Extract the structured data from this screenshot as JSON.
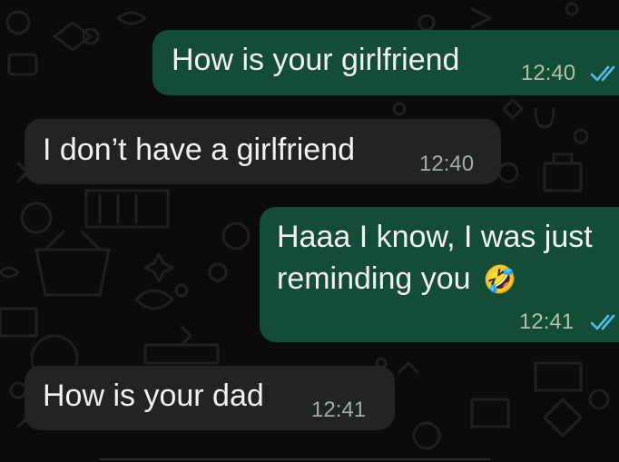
{
  "chat": {
    "messages": [
      {
        "direction": "outgoing",
        "text": "How is your girlfriend",
        "time": "12:40",
        "status": "read-double-check-icon"
      },
      {
        "direction": "incoming",
        "text": "I don’t have a girlfriend",
        "time": "12:40"
      },
      {
        "direction": "outgoing",
        "text_line1": "Haaa I know, I was just",
        "text_line2": "reminding you",
        "emoji": "🤣",
        "time": "12:41",
        "status": "read-double-check-icon"
      },
      {
        "direction": "incoming",
        "text": "How is your dad",
        "time": "12:41"
      }
    ]
  },
  "colors": {
    "background": "#0b0b0b",
    "incoming_bubble": "#222323",
    "outgoing_bubble": "#144d37",
    "read_tick": "#53bdeb",
    "doodle": "#1e1e1e"
  }
}
